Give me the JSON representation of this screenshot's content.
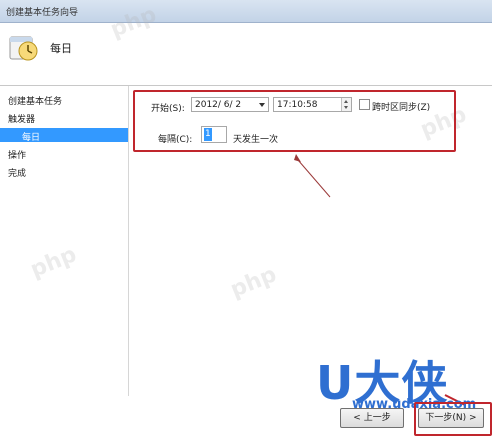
{
  "window": {
    "title": "创建基本任务向导"
  },
  "header": {
    "heading": "每日",
    "icon": "calendar-clock-icon"
  },
  "sidebar": {
    "items": [
      {
        "label": "创建基本任务"
      },
      {
        "label": "触发器"
      },
      {
        "label": "每日"
      },
      {
        "label": "操作"
      },
      {
        "label": "完成"
      }
    ],
    "selected_index": 2
  },
  "form": {
    "start_label": "开始(S):",
    "start_date": "2012/ 6/ 2",
    "start_time": "17:10:58",
    "sync_timezone_label": "跨时区同步(Z)",
    "sync_timezone_checked": false,
    "recur_label": "每隔(C):",
    "recur_value": "1",
    "recur_suffix": "天发生一次"
  },
  "watermark": {
    "brand": "U大侠",
    "url": "www.udaxia.com"
  },
  "buttons": {
    "back_label": "< 上一步",
    "next_label": "下一步(N) >"
  },
  "colors": {
    "accent": "#3399ff",
    "highlight_box": "#c0262d",
    "brand": "#2f6fd1"
  }
}
